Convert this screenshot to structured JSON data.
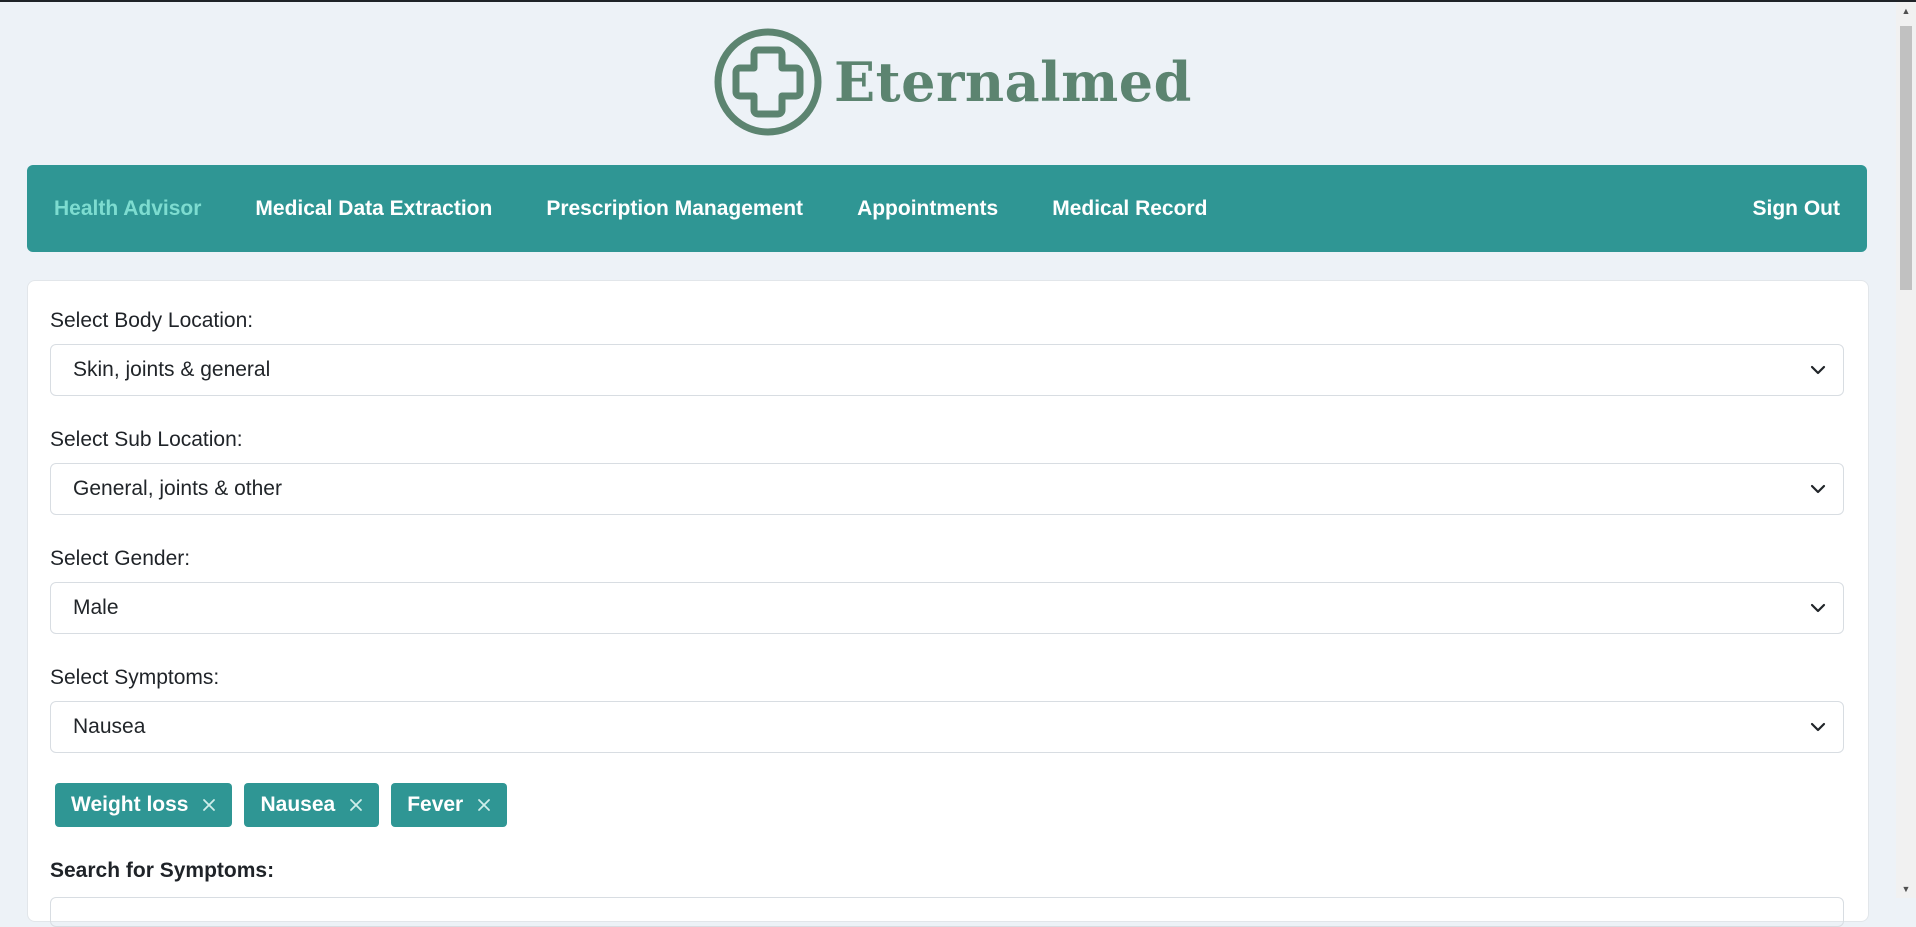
{
  "app": {
    "name": "Eternalmed",
    "logo_icon": "medical-cross-icon",
    "brand_color": "#5c8470",
    "accent_color": "#2f9694"
  },
  "nav": {
    "items": [
      {
        "label": "Health Advisor",
        "active": true
      },
      {
        "label": "Medical Data Extraction",
        "active": false
      },
      {
        "label": "Prescription Management",
        "active": false
      },
      {
        "label": "Appointments",
        "active": false
      },
      {
        "label": "Medical Record",
        "active": false
      }
    ],
    "signout_label": "Sign Out"
  },
  "form": {
    "body_location": {
      "label": "Select Body Location:",
      "value": "Skin, joints & general"
    },
    "sub_location": {
      "label": "Select Sub Location:",
      "value": "General, joints & other"
    },
    "gender": {
      "label": "Select Gender:",
      "value": "Male"
    },
    "symptoms": {
      "label": "Select Symptoms:",
      "value": "Nausea"
    },
    "selected_symptoms": [
      "Weight loss",
      "Nausea",
      "Fever"
    ],
    "search": {
      "label": "Search for Symptoms:"
    }
  }
}
